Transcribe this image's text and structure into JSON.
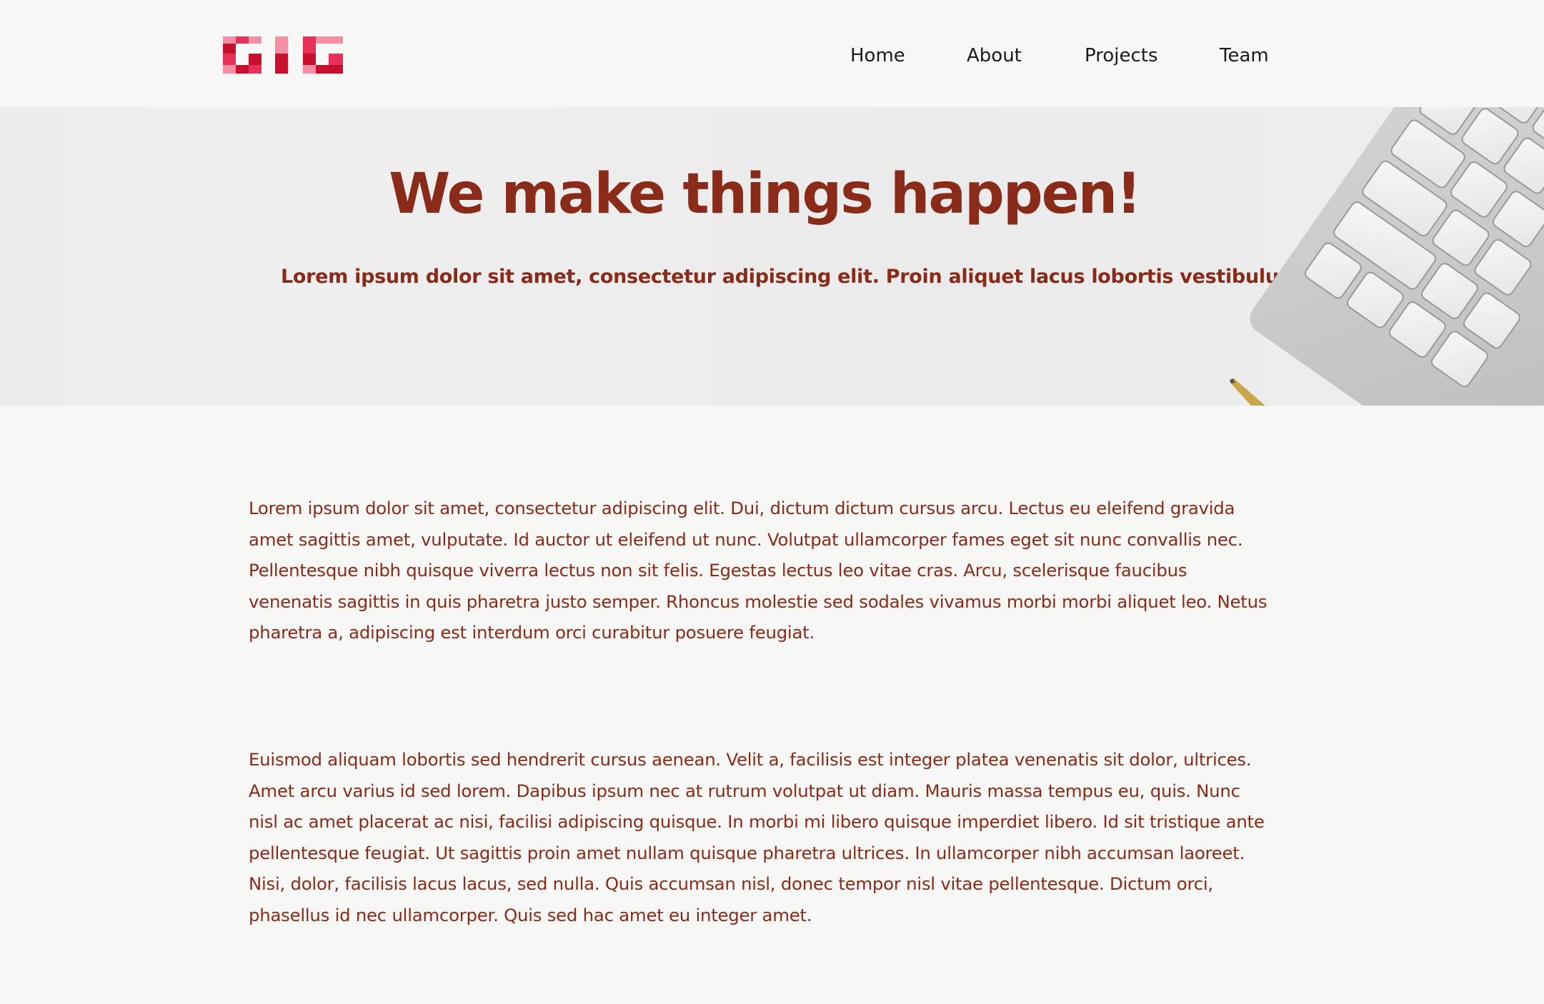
{
  "logo": {
    "alt": "GIG"
  },
  "nav": {
    "items": [
      {
        "label": "Home"
      },
      {
        "label": "About"
      },
      {
        "label": "Projects"
      },
      {
        "label": "Team"
      }
    ]
  },
  "hero": {
    "title": "We make things happen!",
    "subtitle": "Lorem ipsum dolor sit amet, consectetur adipiscing elit. Proin aliquet lacus lobortis vestibulum tellus"
  },
  "content": {
    "paragraphs": [
      "Lorem ipsum dolor sit amet, consectetur adipiscing elit. Dui, dictum dictum cursus arcu. Lectus eu eleifend gravida amet sagittis amet, vulputate. Id auctor ut eleifend ut nunc. Volutpat ullamcorper fames eget sit nunc convallis nec. Pellentesque nibh quisque viverra lectus non sit felis. Egestas lectus leo vitae cras. Arcu, scelerisque faucibus venenatis sagittis in quis pharetra justo semper. Rhoncus molestie sed sodales vivamus morbi morbi aliquet leo. Netus pharetra a, adipiscing est interdum orci curabitur posuere feugiat.",
      "Euismod aliquam lobortis sed hendrerit cursus aenean. Velit a, facilisis est integer platea venenatis sit dolor, ultrices. Amet arcu varius id sed lorem. Dapibus ipsum nec at rutrum volutpat ut diam. Mauris massa tempus eu, quis. Nunc nisl ac amet placerat ac nisi, facilisi adipiscing quisque. In morbi mi libero quisque imperdiet libero. Id sit tristique ante pellentesque feugiat. Ut sagittis proin amet nullam quisque pharetra ultrices. In ullamcorper nibh accumsan laoreet. Nisi, dolor, facilisis lacus lacus, sed nulla. Quis accumsan nisl, donec tempor nisl vitae pellentesque. Dictum orci, phasellus id nec ullamcorper. Quis sed hac amet eu integer amet."
    ]
  },
  "colors": {
    "accent": "#8a2a18",
    "background": "#f7f7f5",
    "logo_dark": "#c8102e",
    "logo_mid": "#e8315a",
    "logo_light": "#f48fa3"
  }
}
